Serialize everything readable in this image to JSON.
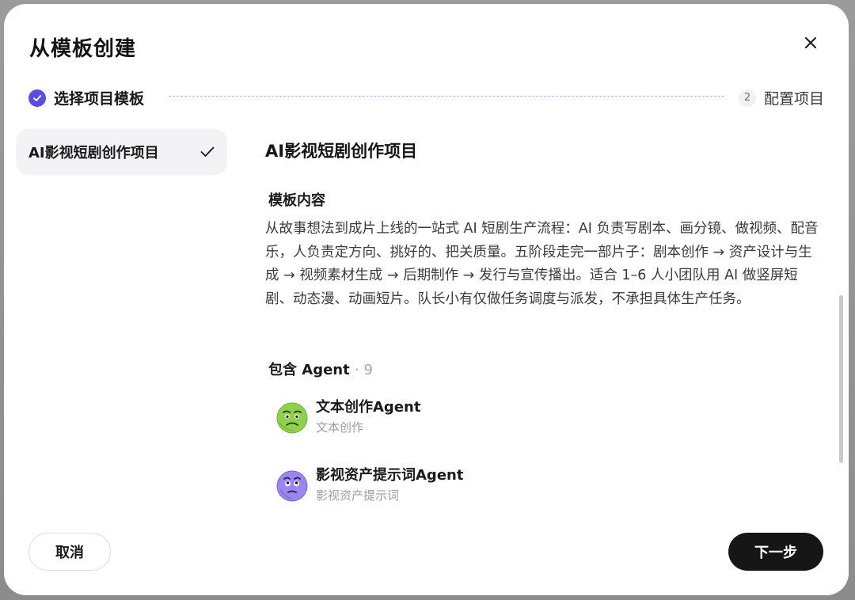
{
  "dialog": {
    "title": "从模板创建"
  },
  "stepper": {
    "steps": [
      {
        "label": "选择项目模板",
        "status": "done"
      },
      {
        "number": "2",
        "label": "配置项目",
        "status": "pending"
      }
    ],
    "accent_color": "#5b4de0"
  },
  "template_list": {
    "items": [
      {
        "label": "AI影视短剧创作项目",
        "selected": true
      }
    ]
  },
  "detail": {
    "title": "AI影视短剧创作项目",
    "content_label": "模板内容",
    "description": "从故事想法到成片上线的一站式 AI 短剧生产流程：AI 负责写剧本、画分镜、做视频、配音乐，人负责定方向、挑好的、把关质量。五阶段走完一部片子：剧本创作 → 资产设计与生成 → 视频素材生成 → 后期制作 → 发行与宣传播出。适合 1–6 人小团队用 AI 做竖屏短剧、动态漫、动画短片。队长小有仅做任务调度与派发，不承担具体生产任务。",
    "agents_label": "包含 Agent",
    "agents_count": "· 9",
    "agents": [
      {
        "name": "文本创作Agent",
        "subtitle": "文本创作",
        "avatar_icon": "green-face-avatar-icon",
        "color": "#8fd14f"
      },
      {
        "name": "影视资产提示词Agent",
        "subtitle": "影视资产提示词",
        "avatar_icon": "purple-face-avatar-icon",
        "color": "#9b86f0"
      }
    ]
  },
  "footer": {
    "cancel_label": "取消",
    "next_label": "下一步"
  }
}
